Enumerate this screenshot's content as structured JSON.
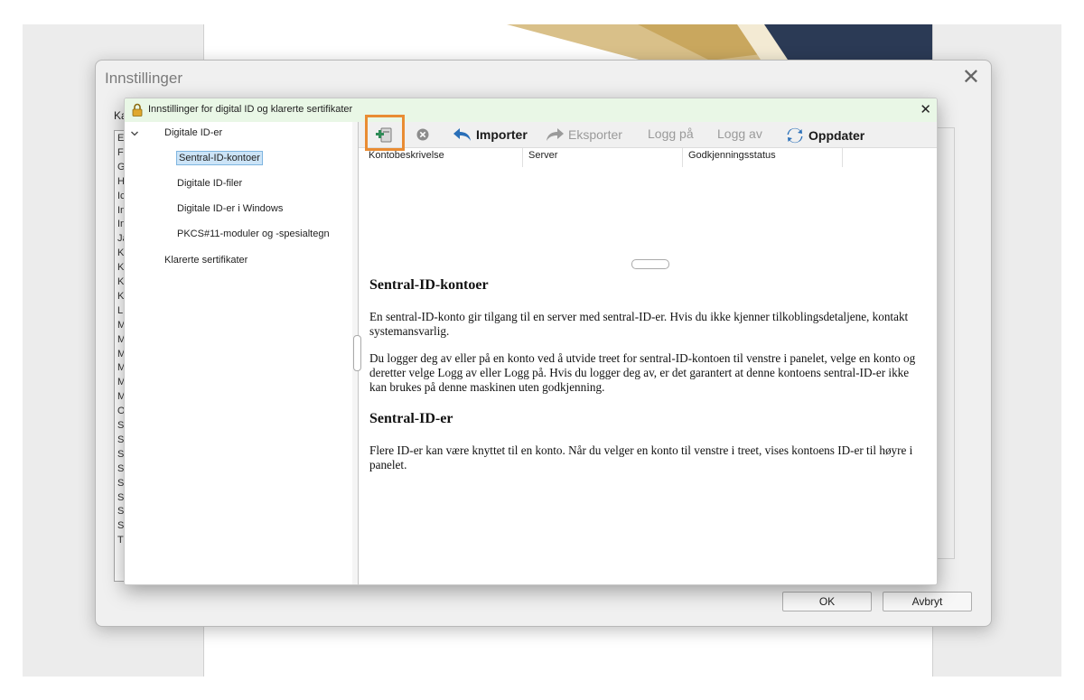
{
  "outer_dialog": {
    "title": "Innstillinger",
    "category_label": "Ka",
    "category_letters": [
      "E",
      "F",
      "G",
      "H",
      "Ic",
      "In",
      "In",
      "Ja",
      "K",
      "K",
      "K",
      "K",
      "L",
      "M",
      "M",
      "M",
      "M",
      "M",
      "M",
      "O",
      "S",
      "S",
      "S",
      "S",
      "S",
      "S",
      "S",
      "S",
      "T"
    ],
    "ok_label": "OK",
    "cancel_label": "Avbryt"
  },
  "inner_dialog": {
    "title": "Innstillinger for digital ID og klarerte sertifikater",
    "tree": {
      "root": "Digitale ID-er",
      "children": [
        "Sentral-ID-kontoer",
        "Digitale ID-filer",
        "Digitale ID-er i Windows",
        "PKCS#11-moduler og -spesialtegn"
      ],
      "sibling": "Klarerte sertifikater"
    },
    "toolbar": {
      "import": "Importer",
      "export": "Eksporter",
      "login": "Logg på",
      "logout": "Logg av",
      "refresh": "Oppdater"
    },
    "table": {
      "columns": [
        "Kontobeskrivelse",
        "Server",
        "Godkjenningsstatus"
      ]
    },
    "help": {
      "heading1": "Sentral-ID-kontoer",
      "para1": "En sentral-ID-konto gir tilgang til en server med sentral-ID-er. Hvis du ikke kjenner tilkoblingsdetaljene, kontakt systemansvarlig.",
      "para2": "Du logger deg av eller på en konto ved å utvide treet for sentral-ID-kontoen til venstre i panelet, velge en konto og deretter velge Logg av eller Logg på. Hvis du logger deg av, er det garantert at denne kontoens sentral-ID-er ikke kan brukes på denne maskinen uten godkjenning.",
      "heading2": "Sentral-ID-er",
      "para3": "Flere ID-er kan være knyttet til en konto. Når du velger en konto til venstre i treet, vises kontoens ID-er til høyre i panelet."
    }
  },
  "icons": {
    "add": "add-account-icon",
    "delete": "delete-icon",
    "import": "import-arrow-icon",
    "export": "export-arrow-icon",
    "refresh": "refresh-icon",
    "lock": "lock-icon",
    "chevron": "chevron-down-icon"
  },
  "colors": {
    "highlight": "#e98c33",
    "selected": "#cce4f7",
    "title_bar": "#e9f7e6",
    "refresh_blue": "#2a6fb8"
  }
}
